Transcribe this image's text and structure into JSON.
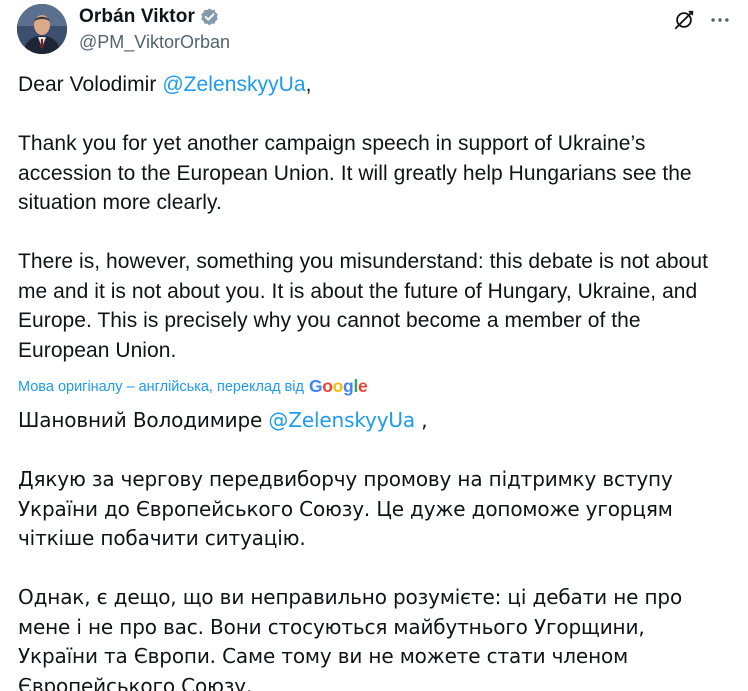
{
  "author": {
    "display_name": "Orbán Viktor",
    "handle": "@PM_ViktorOrban"
  },
  "icons": {
    "verified": "verified-badge-icon",
    "grok": "grok-icon",
    "more": "more-options-icon"
  },
  "colors": {
    "link": "#1d9bf0",
    "text": "#0f1419",
    "muted": "#536471",
    "background": "#ffffff"
  },
  "tweet": {
    "greeting_prefix": "Dear Volodimir ",
    "greeting_mention": "@ZelenskyyUa",
    "greeting_suffix": ",",
    "paragraph_1": "Thank you for yet another campaign speech in support of Ukraine’s accession to the European Union. It will greatly help Hungarians see the situation more clearly.",
    "paragraph_2": "There is, however, something you misunderstand: this debate is not about me and it is not about you. It is about the future of Hungary, Ukraine, and Europe. This is precisely why you cannot become a member of the European Union."
  },
  "translation": {
    "note": "Мова оригіналу – англійська, переклад від",
    "provider": "Google",
    "greeting_prefix": "Шановний Володимире ",
    "greeting_mention": "@ZelenskyyUa",
    "greeting_suffix": " ,",
    "paragraph_1": "Дякую за чергову передвиборчу промову на підтримку вступу України до Європейського Союзу. Це дуже допоможе угорцям чіткіше побачити ситуацію.",
    "paragraph_2": "Однак, є дещо, що ви неправильно розумієте: ці дебати не про мене і не про вас. Вони стосуються майбутнього Угорщини, України та Європи. Саме тому ви не можете стати членом Європейського Союзу."
  }
}
